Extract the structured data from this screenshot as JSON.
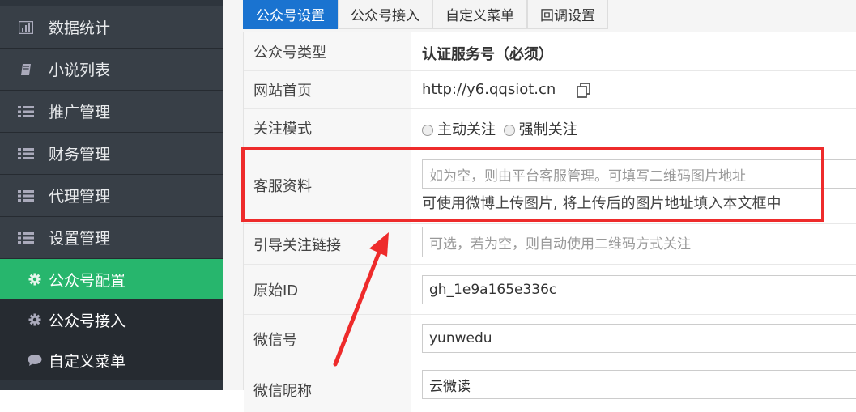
{
  "sidebar": {
    "items": [
      {
        "label": "数据统计",
        "icon": "bar-chart-icon"
      },
      {
        "label": "小说列表",
        "icon": "book-icon"
      },
      {
        "label": "推广管理",
        "icon": "list-icon"
      },
      {
        "label": "财务管理",
        "icon": "list-icon"
      },
      {
        "label": "代理管理",
        "icon": "list-icon"
      },
      {
        "label": "设置管理",
        "icon": "list-icon"
      }
    ],
    "sub_items": [
      {
        "label": "公众号配置",
        "icon": "gear-icon",
        "active": true
      },
      {
        "label": "公众号接入",
        "icon": "gear-icon"
      },
      {
        "label": "自定义菜单",
        "icon": "chat-bubble-icon"
      }
    ]
  },
  "tabs": [
    "公众号设置",
    "公众号接入",
    "自定义菜单",
    "回调设置"
  ],
  "form": {
    "account_type_label": "公众号类型",
    "account_type_value": "认证服务号（必须）",
    "homepage_label": "网站首页",
    "homepage_value": "http://y6.qqsiot.cn",
    "follow_mode_label": "关注模式",
    "follow_mode_options": [
      "主动关注",
      "强制关注"
    ],
    "service_label": "客服资料",
    "service_placeholder": "如为空，则由平台客服管理。可填写二维码图片地址",
    "service_help": "可使用微博上传图片, 将上传后的图片地址填入本文框中",
    "guide_label": "引导关注链接",
    "guide_placeholder": "可选，若为空，则自动使用二维码方式关注",
    "original_id_label": "原始ID",
    "original_id_value": "gh_1e9a165e336c",
    "wechat_label": "微信号",
    "wechat_value": "yunwedu",
    "nickname_label": "微信昵称",
    "nickname_value": "云微读"
  },
  "colors": {
    "sidebar_bg": "#2e353d",
    "active_green": "#27b66d",
    "tab_active": "#1a73d0",
    "highlight_red": "#ee2b2b"
  }
}
